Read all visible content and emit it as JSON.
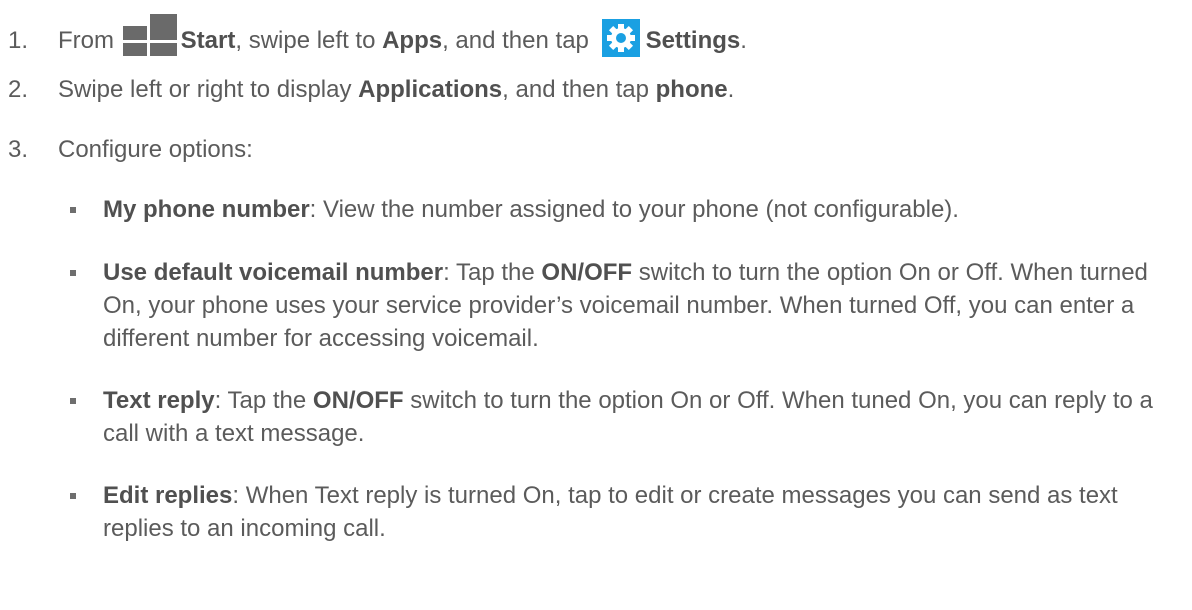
{
  "steps": [
    {
      "number": "1.",
      "t1": "From ",
      "start_label": "Start",
      "t2": ", swipe left to ",
      "apps_label": "Apps",
      "t3": ", and then tap ",
      "settings_label": "Settings",
      "t4": "."
    },
    {
      "number": "2.",
      "t1": "Swipe left or right to display ",
      "b1": "Applications",
      "t2": ", and then tap ",
      "b2": "phone",
      "t3": "."
    },
    {
      "number": "3.",
      "text": "Configure options:"
    }
  ],
  "options": [
    {
      "title": "My phone number",
      "desc": ": View the number assigned to your phone (not configurable)."
    },
    {
      "title": "Use default voicemail number",
      "d1": ": Tap the ",
      "switch_label": "ON/OFF",
      "d2": " switch to turn the option On or Off. When turned On, your phone uses your service provider’s voicemail number. When turned Off, you can enter a different number for accessing voicemail."
    },
    {
      "title": "Text reply",
      "d1": ": Tap the ",
      "switch_label": "ON/OFF",
      "d2": " switch to turn the option On or Off. When tuned On, you can reply to a call with a text message."
    },
    {
      "title": "Edit replies",
      "desc": ": When Text reply is turned On, tap to edit or create messages you can send as text replies to an incoming call."
    }
  ],
  "icons": {
    "start": "windows-start-icon",
    "settings": "gear-settings-icon",
    "settings_color": "#1aa0e2"
  }
}
